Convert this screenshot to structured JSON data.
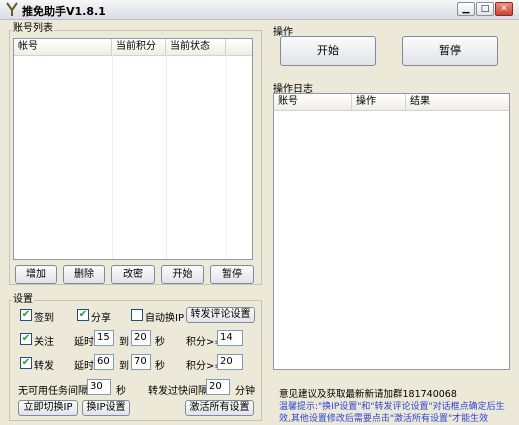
{
  "window": {
    "title": "推免助手V1.8.1",
    "icons": [
      "app-logo-icon",
      "minimize-icon",
      "maximize-icon",
      "close-icon"
    ]
  },
  "accounts": {
    "title": "账号列表",
    "columns": [
      "帐号",
      "当前积分",
      "当前状态"
    ]
  },
  "account_buttons": {
    "add": "增加",
    "delete": "删除",
    "change_password": "改密",
    "start": "开始",
    "pause": "暂停"
  },
  "settings": {
    "title": "设置",
    "sign_in": {
      "label": "签到",
      "checked": true
    },
    "share": {
      "label": "分享",
      "checked": true
    },
    "auto_switch_ip": {
      "label": "自动换IP",
      "checked": false
    },
    "forward_comment_settings": "转发评论设置",
    "follow": {
      "label": "关注",
      "checked": true
    },
    "forward": {
      "label": "转发",
      "checked": true
    },
    "delay_label": "延时",
    "to_label": "到",
    "seconds_label": "秒",
    "points_label": "积分>=",
    "follow_delay_from": "15",
    "follow_delay_to": "20",
    "follow_points": "14",
    "forward_delay_from": "60",
    "forward_delay_to": "70",
    "forward_points": "20",
    "no_task_label": "无可用任务间隔",
    "no_task_value": "30",
    "no_task_unit": "秒",
    "forward_fast_label": "转发过快间隔",
    "forward_fast_value": "20",
    "forward_fast_unit": "分钟",
    "switch_ip_now": "立即切换IP",
    "ip_settings": "换IP设置",
    "activate_all": "激活所有设置"
  },
  "operations": {
    "title": "操作",
    "start": "开始",
    "pause": "暂停"
  },
  "log": {
    "title": "操作日志",
    "columns": [
      "账号",
      "操作",
      "结果"
    ]
  },
  "footer": {
    "feedback": "意见建议及获取最新新请加群181740068",
    "tip_line1": "温馨提示:\"换IP设置\"和\"转发评论设置\"对话框点确定后生",
    "tip_line2": "效,其他设置修改后需要点击\"激活所有设置\"才能生效"
  },
  "colors": {
    "background": "#ece9d8",
    "checkmark": "#21a121",
    "tip_text": "#2f45d6"
  }
}
